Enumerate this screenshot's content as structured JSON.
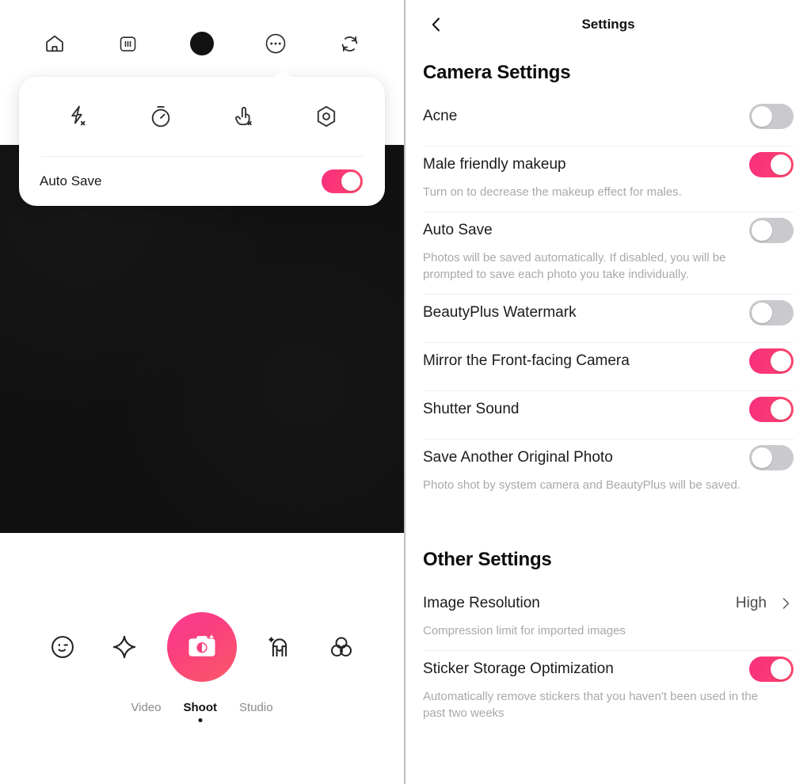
{
  "camera": {
    "topbar": [
      {
        "name": "home-icon",
        "label": "Home"
      },
      {
        "name": "aspect-ratio-icon",
        "label": "1:1"
      },
      {
        "name": "shutter-dot-icon",
        "label": "Shutter"
      },
      {
        "name": "more-options-icon",
        "label": "More"
      },
      {
        "name": "camera-flip-icon",
        "label": "Flip Camera"
      }
    ],
    "dropdown": {
      "icons": [
        {
          "name": "flash-off-icon",
          "label": "Flash Off"
        },
        {
          "name": "timer-icon",
          "label": "Timer"
        },
        {
          "name": "touch-shoot-off-icon",
          "label": "Touch Shoot Off"
        },
        {
          "name": "lens-filter-icon",
          "label": "Lens"
        }
      ],
      "auto_save_label": "Auto Save",
      "auto_save_on": true
    },
    "tools": [
      {
        "name": "beautify-face-icon",
        "label": "Beautify"
      },
      {
        "name": "retouch-sparkle-icon",
        "label": "Retouch"
      },
      {
        "name": "shutter-button",
        "label": "Shoot"
      },
      {
        "name": "sticker-avatar-icon",
        "label": "Stickers"
      },
      {
        "name": "filters-icon",
        "label": "Filters"
      }
    ],
    "modes": [
      {
        "label": "Video",
        "active": false
      },
      {
        "label": "Shoot",
        "active": true
      },
      {
        "label": "Studio",
        "active": false
      }
    ]
  },
  "settings": {
    "header": {
      "title": "Settings",
      "back_icon": "chevron-left-icon"
    },
    "sections": [
      {
        "title": "Camera Settings",
        "rows": [
          {
            "label": "Acne",
            "desc": "",
            "control": "toggle",
            "on": false
          },
          {
            "label": "Male friendly makeup",
            "desc": "Turn on to decrease the makeup effect for males.",
            "control": "toggle",
            "on": true
          },
          {
            "label": "Auto Save",
            "desc": "Photos will be saved automatically. If disabled, you will be prompted to save each photo you take individually.",
            "control": "toggle",
            "on": false
          },
          {
            "label": "BeautyPlus Watermark",
            "desc": "",
            "control": "toggle",
            "on": false
          },
          {
            "label": "Mirror the Front-facing Camera",
            "desc": "",
            "control": "toggle",
            "on": true
          },
          {
            "label": "Shutter Sound",
            "desc": "",
            "control": "toggle",
            "on": true
          },
          {
            "label": "Save Another Original Photo",
            "desc": "Photo shot by system camera and BeautyPlus will be saved.",
            "control": "toggle",
            "on": false
          }
        ]
      },
      {
        "title": "Other Settings",
        "rows": [
          {
            "label": "Image Resolution",
            "desc": "Compression limit for imported images",
            "control": "value",
            "value": "High"
          },
          {
            "label": "Sticker Storage Optimization",
            "desc": "Automatically remove stickers that you haven't been used in the past two weeks",
            "control": "toggle",
            "on": true
          }
        ]
      }
    ]
  },
  "colors": {
    "accent_pink": "#FB3A7E",
    "accent_pink_light": "#FF4B6E",
    "toggle_off": "#C9C9CE",
    "viewfinder": "#111111",
    "text_primary": "#1B1B1B",
    "text_muted": "#A9A9AE"
  }
}
